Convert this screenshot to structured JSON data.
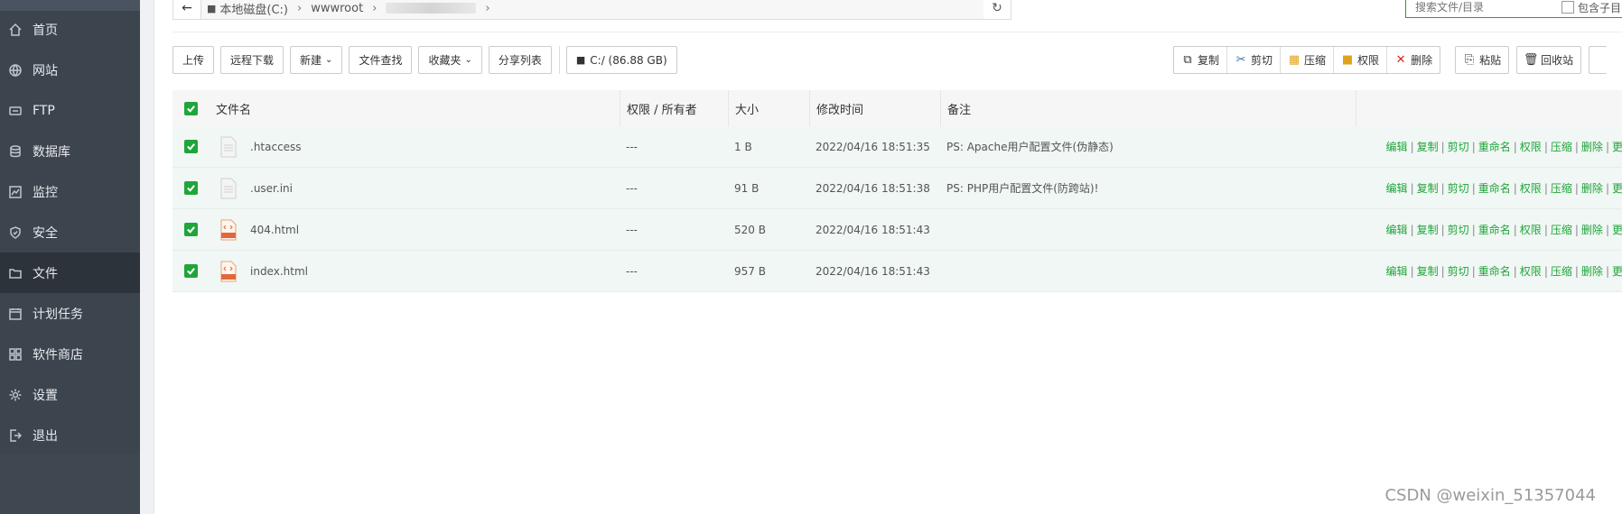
{
  "sidebar": {
    "items": [
      {
        "label": "首页",
        "icon": "home-icon"
      },
      {
        "label": "网站",
        "icon": "globe-icon"
      },
      {
        "label": "FTP",
        "icon": "ftp-icon"
      },
      {
        "label": "数据库",
        "icon": "database-icon"
      },
      {
        "label": "监控",
        "icon": "monitor-icon"
      },
      {
        "label": "安全",
        "icon": "shield-icon"
      },
      {
        "label": "文件",
        "icon": "folder-icon",
        "active": true
      },
      {
        "label": "计划任务",
        "icon": "calendar-icon"
      },
      {
        "label": "软件商店",
        "icon": "apps-icon"
      },
      {
        "label": "设置",
        "icon": "gear-icon"
      },
      {
        "label": "退出",
        "icon": "logout-icon"
      }
    ]
  },
  "path": {
    "disk": "本地磁盘(C:)",
    "folder": "wwwroot"
  },
  "search": {
    "placeholder": "搜索文件/目录",
    "include_sub_label": "包含子目"
  },
  "toolbar": {
    "upload": "上传",
    "remote_download": "远程下载",
    "new": "新建",
    "file_search": "文件查找",
    "favorites": "收藏夹",
    "share_list": "分享列表",
    "disk_info": "C:/ (86.88 GB)"
  },
  "batch": {
    "copy": "复制",
    "cut": "剪切",
    "compress": "压缩",
    "permission": "权限",
    "delete": "删除",
    "paste": "粘贴",
    "recycle": "回收站"
  },
  "table": {
    "headers": {
      "name": "文件名",
      "perm": "权限 / 所有者",
      "size": "大小",
      "mtime": "修改时间",
      "note": "备注"
    },
    "rows": [
      {
        "name": ".htaccess",
        "perm": "---",
        "size": "1 B",
        "mtime": "2022/04/16 18:51:35",
        "note": "PS: Apache用户配置文件(伪静态)",
        "type": "text"
      },
      {
        "name": ".user.ini",
        "perm": "---",
        "size": "91 B",
        "mtime": "2022/04/16 18:51:38",
        "note": "PS: PHP用户配置文件(防跨站)!",
        "type": "text"
      },
      {
        "name": "404.html",
        "perm": "---",
        "size": "520 B",
        "mtime": "2022/04/16 18:51:43",
        "note": "",
        "type": "html"
      },
      {
        "name": "index.html",
        "perm": "---",
        "size": "957 B",
        "mtime": "2022/04/16 18:51:43",
        "note": "",
        "type": "html"
      }
    ],
    "row_ops": [
      "编辑",
      "复制",
      "剪切",
      "重命名",
      "权限",
      "压缩",
      "删除",
      "更"
    ]
  },
  "watermark": "CSDN @weixin_51357044",
  "colors": {
    "sidebar_bg": "#3c444d",
    "accent_green": "#20a53a",
    "row_bg": "#f0f7f4"
  }
}
